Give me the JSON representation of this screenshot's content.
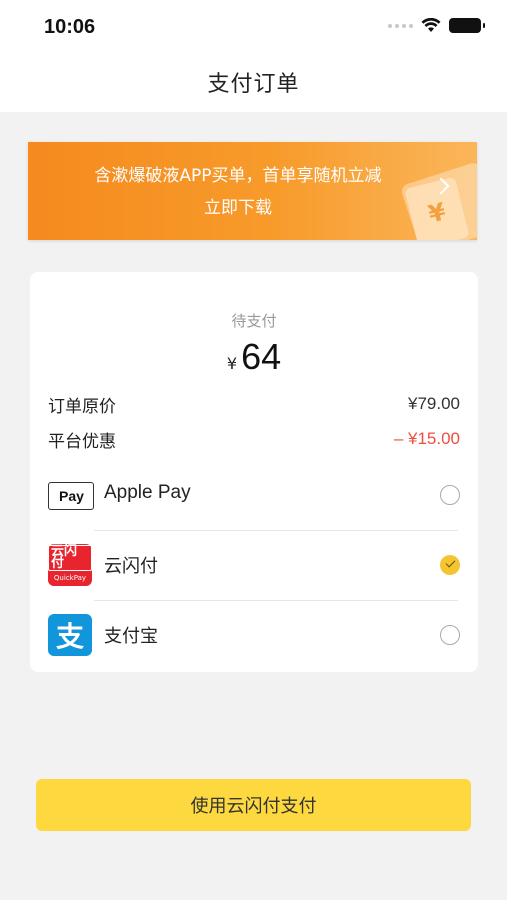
{
  "status_bar": {
    "time": "10:06"
  },
  "nav": {
    "title": "支付订单"
  },
  "banner": {
    "line1": "含漱爆破液APP买单，首单享随机立减",
    "line2": "立即下载",
    "ticket_symbol": "¥"
  },
  "order": {
    "pending_label": "待支付",
    "currency_symbol": "¥",
    "amount": "64",
    "original_label": "订单原价",
    "original_value": "¥79.00",
    "discount_label": "平台优惠",
    "discount_value": "– ¥15.00"
  },
  "payment_methods": [
    {
      "name": "Apple Pay",
      "icon": "apple-pay-icon",
      "selected": false,
      "icon_text": "Pay"
    },
    {
      "name": "云闪付",
      "icon": "unionpay-quickpass-icon",
      "selected": true,
      "icon_text": "云闪付",
      "icon_sub": "QuickPay"
    },
    {
      "name": "支付宝",
      "icon": "alipay-icon",
      "selected": false,
      "icon_text": "支"
    }
  ],
  "actions": {
    "pay_button_label": "使用云闪付支付"
  },
  "colors": {
    "accent_yellow": "#fdd83f",
    "banner_orange": "#f58a1f",
    "discount_red": "#f04d3f",
    "alipay_blue": "#1296db",
    "unionpay_red": "#e8242f"
  }
}
